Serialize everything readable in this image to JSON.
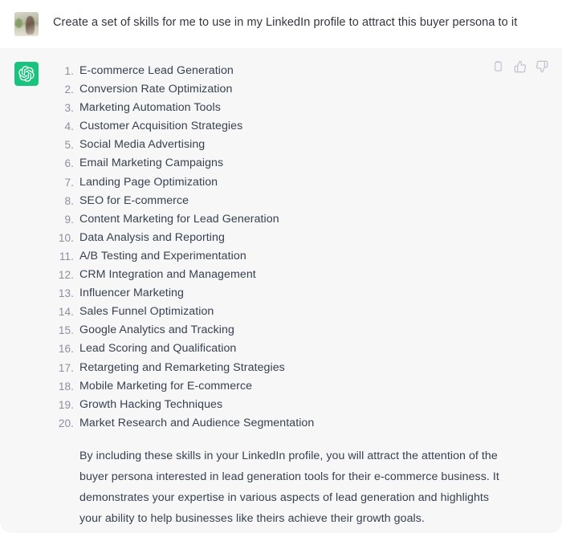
{
  "conversation": {
    "user_turn": {
      "avatar_alt": "user-profile-photo",
      "message": "Create a set of skills for me to use in my LinkedIn profile to attract this buyer persona to it"
    },
    "assistant_turn": {
      "avatar_label": "ChatGPT",
      "skills": [
        "E-commerce Lead Generation",
        "Conversion Rate Optimization",
        "Marketing Automation Tools",
        "Customer Acquisition Strategies",
        "Social Media Advertising",
        "Email Marketing Campaigns",
        "Landing Page Optimization",
        "SEO for E-commerce",
        "Content Marketing for Lead Generation",
        "Data Analysis and Reporting",
        "A/B Testing and Experimentation",
        "CRM Integration and Management",
        "Influencer Marketing",
        "Sales Funnel Optimization",
        "Google Analytics and Tracking",
        "Lead Scoring and Qualification",
        "Retargeting and Remarketing Strategies",
        "Mobile Marketing for E-commerce",
        "Growth Hacking Techniques",
        "Market Research and Audience Segmentation"
      ],
      "closing_paragraph": "By including these skills in your LinkedIn profile, you will attract the attention of the buyer persona interested in lead generation tools for their e-commerce business. It demonstrates your expertise in various aspects of lead generation and highlights your ability to help businesses like theirs achieve their growth goals.",
      "actions": [
        {
          "name": "copy-icon",
          "title": "Copy"
        },
        {
          "name": "thumbs-up-icon",
          "title": "Good response"
        },
        {
          "name": "thumbs-down-icon",
          "title": "Bad response"
        }
      ]
    }
  },
  "colors": {
    "user_background": "#ffffff",
    "assistant_background": "#f7f7f8",
    "brand_green": "#19c37d",
    "body_text": "#374151",
    "list_number": "#8e8ea0",
    "icon_gray": "#c5c5d2"
  }
}
